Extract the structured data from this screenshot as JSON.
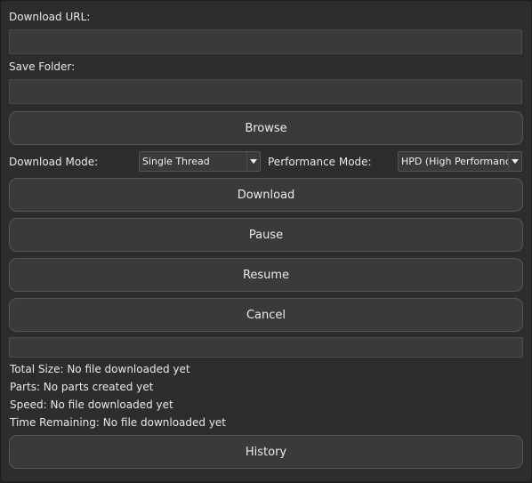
{
  "url": {
    "label": "Download URL:",
    "value": ""
  },
  "folder": {
    "label": "Save Folder:",
    "value": ""
  },
  "buttons": {
    "browse": "Browse",
    "download": "Download",
    "pause": "Pause",
    "resume": "Resume",
    "cancel": "Cancel",
    "history": "History"
  },
  "download_mode": {
    "label": "Download Mode:",
    "selected": "Single Thread"
  },
  "performance_mode": {
    "label": "Performance Mode:",
    "selected": "HPD (High Performance)"
  },
  "progress": {
    "percent": 0
  },
  "status": {
    "total_size": "Total Size: No file downloaded yet",
    "parts": "Parts: No parts created yet",
    "speed": "Speed: No file downloaded yet",
    "time_remaining": "Time Remaining: No file downloaded yet"
  },
  "icons": {
    "dropdown": "chevron-down-icon"
  },
  "colors": {
    "window_bg": "#2d2d2d",
    "control_bg": "#3a3a3a",
    "text": "#e6e6e6"
  }
}
